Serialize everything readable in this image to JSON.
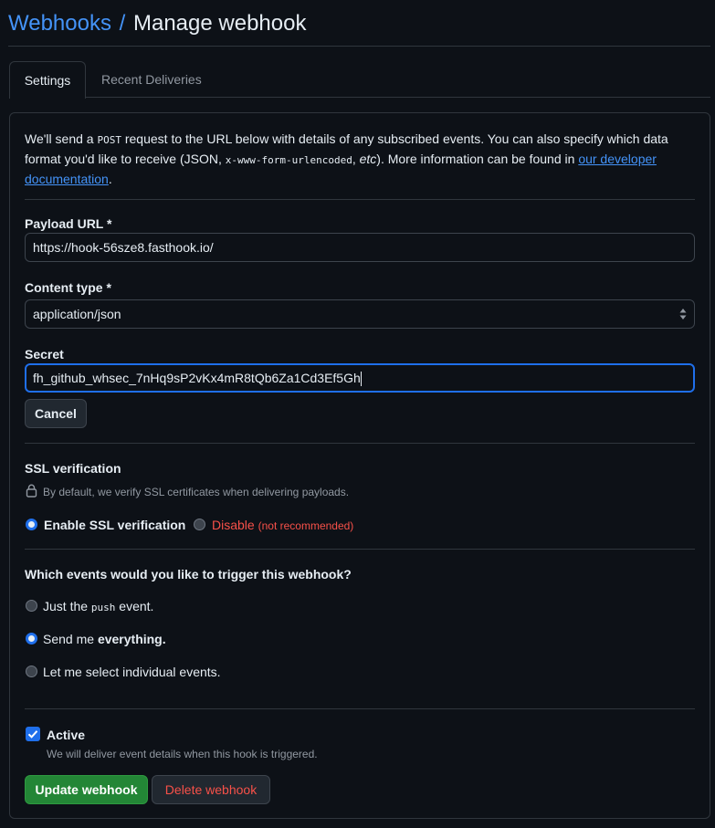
{
  "header": {
    "breadcrumb_parent": "Webhooks",
    "separator": "/",
    "title": "Manage webhook"
  },
  "tabs": [
    {
      "label": "Settings",
      "active": true
    },
    {
      "label": "Recent Deliveries",
      "active": false
    }
  ],
  "intro": {
    "part1": "We'll send a ",
    "code1": "POST",
    "part2": " request to the URL below with details of any subscribed events. You can also specify which data format you'd like to receive (JSON, ",
    "code2": "x-www-form-urlencoded",
    "part3": ", ",
    "etc": "etc",
    "part4": "). More information can be found in ",
    "link": "our developer documentation",
    "part5": "."
  },
  "payload_url": {
    "label": "Payload URL *",
    "value": "https://hook-56sze8.fasthook.io/"
  },
  "content_type": {
    "label": "Content type *",
    "selected": "application/json"
  },
  "secret": {
    "label": "Secret",
    "value": "fh_github_whsec_7nHq9sP2vKx4mR8tQb6Za1Cd3Ef5Gh",
    "cancel_label": "Cancel"
  },
  "ssl": {
    "heading": "SSL verification",
    "note": "By default, we verify SSL certificates when delivering payloads.",
    "enable_label": "Enable SSL verification",
    "disable_label": "Disable",
    "disable_note": "(not recommended)",
    "selected": "enable"
  },
  "events": {
    "question": "Which events would you like to trigger this webhook?",
    "options": [
      {
        "prefix": "Just the ",
        "code": "push",
        "suffix": " event.",
        "selected": false
      },
      {
        "prefix": "Send me ",
        "bold": "everything.",
        "selected": true
      },
      {
        "label": "Let me select individual events.",
        "selected": false
      }
    ]
  },
  "active": {
    "label": "Active",
    "checked": true,
    "note": "We will deliver event details when this hook is triggered."
  },
  "actions": {
    "update_label": "Update webhook",
    "delete_label": "Delete webhook"
  },
  "colors": {
    "background": "#0d1117",
    "accent": "#1f6feb",
    "link": "#4493f8",
    "primary_button": "#238636",
    "danger": "#f85149"
  }
}
